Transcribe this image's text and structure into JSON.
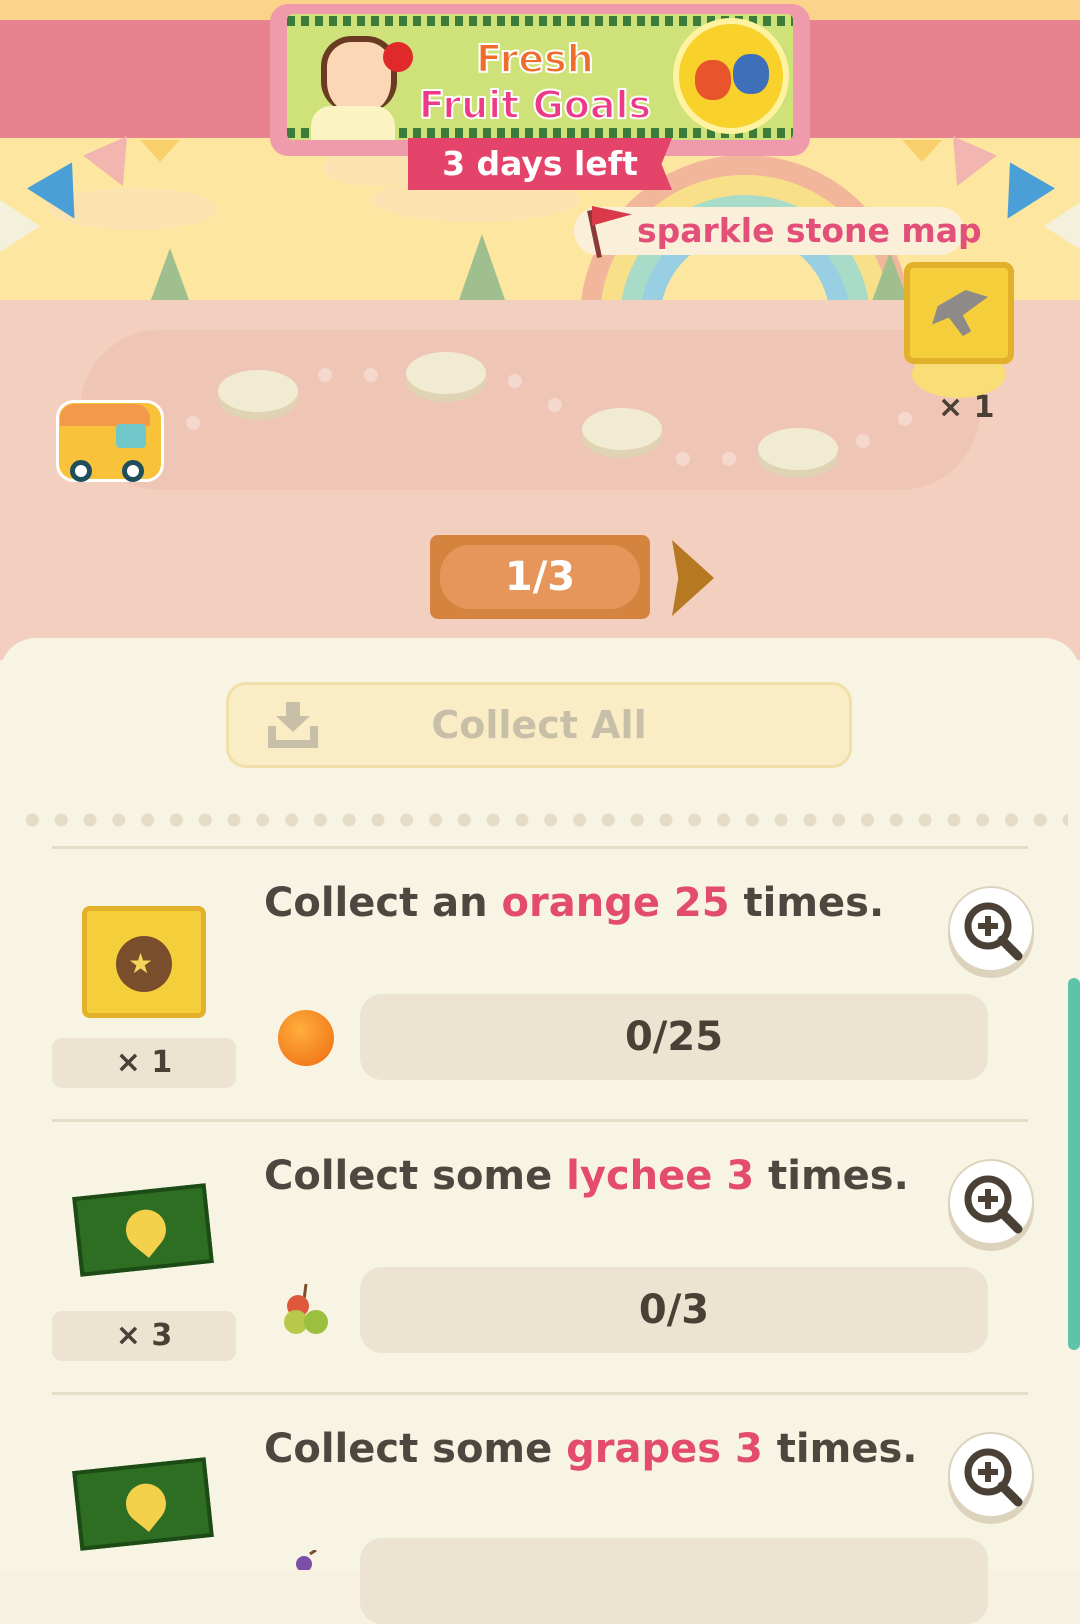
{
  "event": {
    "title_line1": "Fresh",
    "title_line2": "Fruit Goals",
    "days_left": "3 days left"
  },
  "map_label": "sparkle stone map",
  "goal_reward": {
    "icon": "hammer-scroll-icon",
    "count": "× 1"
  },
  "pager": {
    "label": "1/3",
    "current": 1,
    "total": 3
  },
  "collect_all": {
    "label": "Collect All",
    "icon": "download-tray-icon",
    "enabled": false
  },
  "tasks": [
    {
      "text_pre": "Collect an ",
      "fruit": "orange",
      "amount": "25",
      "text_post": " times.",
      "reward_icon": "treasure-map-icon",
      "reward_qty": "× 1",
      "fruit_icon": "orange-icon",
      "progress_label": "0/25",
      "progress": 0
    },
    {
      "text_pre": "Collect some ",
      "fruit": "lychee",
      "amount": "3",
      "text_post": " times.",
      "reward_icon": "leaf-ticket-icon",
      "reward_qty": "× 3",
      "fruit_icon": "lychee-icon",
      "progress_label": "0/3",
      "progress": 0
    },
    {
      "text_pre": "Collect some ",
      "fruit": "grapes",
      "amount": "3",
      "text_post": " times.",
      "reward_icon": "leaf-ticket-icon",
      "fruit_icon": "grapes-icon"
    }
  ],
  "colors": {
    "accent_pink": "#e44c6c",
    "banner_ribbon": "#e5446a",
    "pager_brown": "#d5843f",
    "scrollbar": "#5ec3a7"
  }
}
